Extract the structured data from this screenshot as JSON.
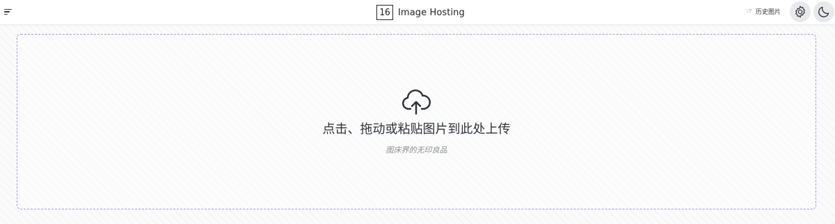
{
  "header": {
    "menu_icon": "menu-icon",
    "logo_text": "16",
    "app_name": "Image Hosting",
    "history_icon": "pointing-hand-icon",
    "history_label": "历史图片",
    "settings_icon": "gear-icon",
    "theme_icon": "moon-icon"
  },
  "upload": {
    "icon": "cloud-upload-icon",
    "title": "点击、拖动或粘贴图片到此处上传",
    "subtitle": "图床界的无印良品"
  },
  "colors": {
    "dropzone_border": "#9f9ad0",
    "icon_color": "#2b2f36",
    "button_bg": "#e8e9ed"
  }
}
